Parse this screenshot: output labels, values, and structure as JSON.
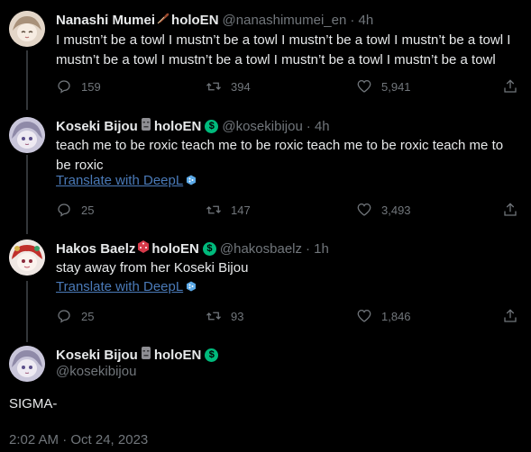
{
  "tweets": [
    {
      "name": "Nanashi Mumei",
      "org": "holoEN",
      "handle": "@nanashimumei_en",
      "time": "· 4h",
      "text": "I mustn’t be a towl I mustn’t be a towl I mustn’t be a towl I mustn’t be a towl I mustn’t be a towl I mustn’t be a towl I mustn’t be a towl I mustn’t be a towl",
      "replies": "159",
      "retweets": "394",
      "likes": "5,941"
    },
    {
      "name": "Koseki Bijou",
      "org": "holoEN",
      "handle": "@kosekibijou",
      "time": "· 4h",
      "text": "teach me to be roxic teach me to be roxic teach me to be roxic teach me to be roxic",
      "translate": "Translate with DeepL",
      "replies": "25",
      "retweets": "147",
      "likes": "3,493"
    },
    {
      "name": "Hakos Baelz",
      "org": "holoEN",
      "handle": "@hakosbaelz",
      "time": "· 1h",
      "text": "stay away from her Koseki Bijou",
      "translate": "Translate with DeepL",
      "replies": "25",
      "retweets": "93",
      "likes": "1,846"
    }
  ],
  "main": {
    "name": "Koseki Bijou",
    "org": "holoEN",
    "handle": "@kosekibijou",
    "text": "SIGMA-",
    "timestamp": "2:02 AM · Oct 24, 2023"
  },
  "colors": {
    "background": "#000000",
    "text": "#e7e9ea",
    "muted": "#71767b",
    "link": "#4a7ab8",
    "verified": "#00ba7c"
  }
}
